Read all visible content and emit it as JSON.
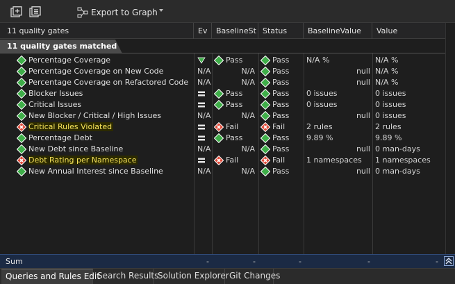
{
  "toolbar": {
    "export_label": "Export to Graph",
    "icons": [
      "expand-all-icon",
      "collapse-all-icon",
      "graph-export-icon",
      "dropdown-arrow-icon"
    ]
  },
  "columns": {
    "name": "11 quality gates",
    "ev": "Ev",
    "baseline_status": "BaselineSt",
    "status": "Status",
    "baseline_value": "BaselineValue",
    "value": "Value"
  },
  "matched_label": "11 quality gates matched",
  "rows": [
    {
      "name": "Percentage Coverage",
      "gate": "pass",
      "highlight": false,
      "ev": "down",
      "bst_icon": "pass",
      "bst": "Pass",
      "st_icon": "pass",
      "st": "Pass",
      "bv": "N/A %",
      "bv_align": "left",
      "val": "N/A %"
    },
    {
      "name": "Percentage Coverage on New Code",
      "gate": "pass",
      "highlight": false,
      "ev": "N/A",
      "bst_icon": "",
      "bst": "N/A",
      "st_icon": "pass",
      "st": "Pass",
      "bv": "null",
      "bv_align": "right",
      "val": "N/A %"
    },
    {
      "name": "Percentage Coverage on Refactored Code",
      "gate": "pass",
      "highlight": false,
      "ev": "N/A",
      "bst_icon": "",
      "bst": "N/A",
      "st_icon": "pass",
      "st": "Pass",
      "bv": "null",
      "bv_align": "right",
      "val": "N/A %"
    },
    {
      "name": "Blocker Issues",
      "gate": "pass",
      "highlight": false,
      "ev": "equal",
      "bst_icon": "pass",
      "bst": "Pass",
      "st_icon": "pass",
      "st": "Pass",
      "bv": "0 issues",
      "bv_align": "left",
      "val": "0 issues"
    },
    {
      "name": "Critical Issues",
      "gate": "pass",
      "highlight": false,
      "ev": "equal",
      "bst_icon": "pass",
      "bst": "Pass",
      "st_icon": "pass",
      "st": "Pass",
      "bv": "0 issues",
      "bv_align": "left",
      "val": "0 issues"
    },
    {
      "name": "New Blocker / Critical / High Issues",
      "gate": "pass",
      "highlight": false,
      "ev": "N/A",
      "bst_icon": "",
      "bst": "N/A",
      "st_icon": "pass",
      "st": "Pass",
      "bv": "null",
      "bv_align": "right",
      "val": "0 issues"
    },
    {
      "name": "Critical Rules Violated",
      "gate": "fail",
      "highlight": true,
      "ev": "equal",
      "bst_icon": "fail",
      "bst": "Fail",
      "st_icon": "fail",
      "st": "Fail",
      "bv": "2 rules",
      "bv_align": "left",
      "val": "2 rules"
    },
    {
      "name": "Percentage Debt",
      "gate": "pass",
      "highlight": false,
      "ev": "equal",
      "bst_icon": "pass",
      "bst": "Pass",
      "st_icon": "pass",
      "st": "Pass",
      "bv": "9.89 %",
      "bv_align": "left",
      "val": "9.89 %"
    },
    {
      "name": "New Debt since Baseline",
      "gate": "pass",
      "highlight": false,
      "ev": "N/A",
      "bst_icon": "",
      "bst": "N/A",
      "st_icon": "pass",
      "st": "Pass",
      "bv": "null",
      "bv_align": "right",
      "val": "0 man-days"
    },
    {
      "name": "Debt Rating per Namespace",
      "gate": "fail",
      "highlight": true,
      "ev": "equal",
      "bst_icon": "fail",
      "bst": "Fail",
      "st_icon": "fail",
      "st": "Fail",
      "bv": "1 namespaces",
      "bv_align": "left",
      "val": "1 namespaces"
    },
    {
      "name": "New Annual Interest since Baseline",
      "gate": "pass",
      "highlight": false,
      "ev": "N/A",
      "bst_icon": "",
      "bst": "N/A",
      "st_icon": "pass",
      "st": "Pass",
      "bv": "null",
      "bv_align": "right",
      "val": "0 man-days"
    }
  ],
  "sum": {
    "label": "Sum",
    "ev": "-",
    "bst": "-",
    "st": "-",
    "bv": "-",
    "val": "-"
  },
  "tabs": [
    {
      "label": "Queries and Rules Edit",
      "active": true
    },
    {
      "label": "Search Results",
      "active": false
    },
    {
      "label": "Solution Explorer",
      "active": false
    },
    {
      "label": "Git Changes",
      "active": false
    }
  ],
  "colors": {
    "pass": "#3fae49",
    "fail": "#e04b3a",
    "highlight_text": "#f6e35a",
    "sum_bg": "#1b2a44"
  }
}
